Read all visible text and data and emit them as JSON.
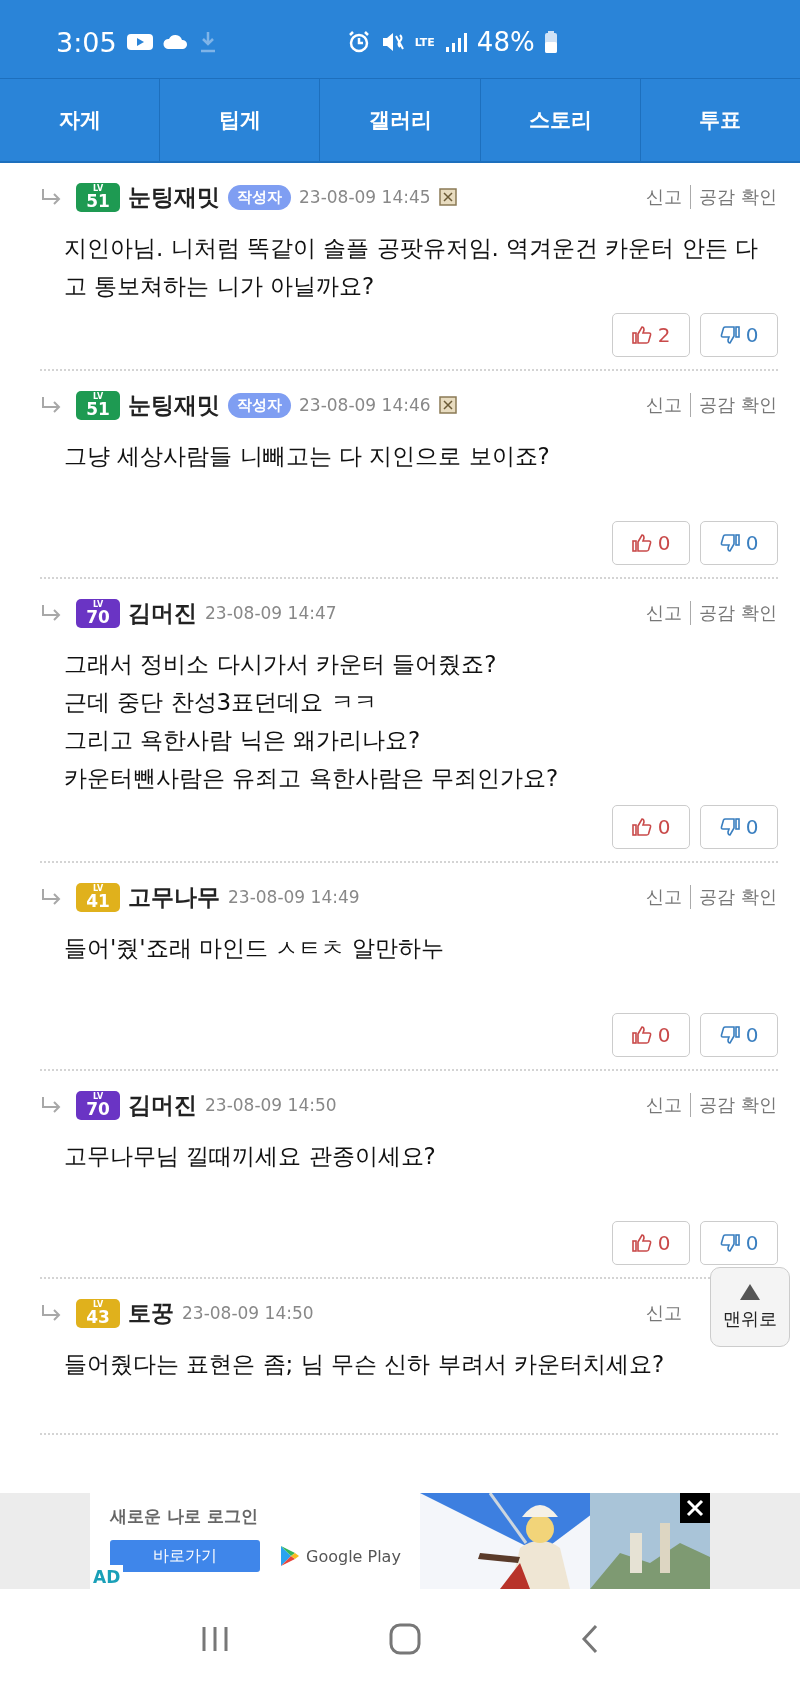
{
  "status_bar": {
    "time": "3:05",
    "network": "LTE",
    "battery": "48%"
  },
  "tabs": [
    {
      "label": "자게",
      "selected": false
    },
    {
      "label": "팁게",
      "selected": false
    },
    {
      "label": "갤러리",
      "selected": false
    },
    {
      "label": "스토리",
      "selected": false
    },
    {
      "label": "투표",
      "selected": false
    }
  ],
  "comments": [
    {
      "lv_label": "LV",
      "level": "51",
      "color": "#1e9a52",
      "author": "눈팅재밋",
      "author_badge": "작성자",
      "date": "23-08-09 14:45",
      "marked": true,
      "actions": [
        "신고",
        "공감 확인"
      ],
      "body": [
        "지인아님. 니처럼 똑같이 솔플 공팟유저임. 역겨운건 카운터 안든 다고 통보쳐하는 니가 아닐까요?"
      ],
      "votes": {
        "up": "2",
        "down": "0"
      }
    },
    {
      "lv_label": "LV",
      "level": "51",
      "color": "#1e9a52",
      "author": "눈팅재밋",
      "author_badge": "작성자",
      "date": "23-08-09 14:46",
      "marked": true,
      "actions": [
        "신고",
        "공감 확인"
      ],
      "body": [
        "그냥 세상사람들 니빼고는 다 지인으로 보이죠?"
      ],
      "votes": {
        "up": "0",
        "down": "0"
      }
    },
    {
      "lv_label": "LV",
      "level": "70",
      "color": "#6a34c4",
      "author": "김머진",
      "date": "23-08-09 14:47",
      "marked": false,
      "actions": [
        "신고",
        "공감 확인"
      ],
      "body": [
        "그래서 정비소 다시가서 카운터 들어줬죠?",
        "근데 중단 찬성3표던데요 ㅋㅋ",
        "그리고 욕한사람 닉은 왜가리나요?",
        "카운터뺀사람은 유죄고 욕한사람은 무죄인가요?"
      ],
      "votes": {
        "up": "0",
        "down": "0"
      }
    },
    {
      "lv_label": "LV",
      "level": "41",
      "color": "#e0b11c",
      "author": "고무나무",
      "date": "23-08-09 14:49",
      "marked": false,
      "actions": [
        "신고",
        "공감 확인"
      ],
      "body": [
        "들어'줬'죠래 마인드 ㅅㅌㅊ 알만하누"
      ],
      "votes": {
        "up": "0",
        "down": "0"
      }
    },
    {
      "lv_label": "LV",
      "level": "70",
      "color": "#6a34c4",
      "author": "김머진",
      "date": "23-08-09 14:50",
      "marked": false,
      "actions": [
        "신고",
        "공감 확인"
      ],
      "body": [
        "고무나무님 낄때끼세요 관종이세요?"
      ],
      "votes": {
        "up": "0",
        "down": "0"
      }
    },
    {
      "lv_label": "LV",
      "level": "43",
      "color": "#e0b11c",
      "author": "토꿍",
      "date": "23-08-09 14:50",
      "marked": false,
      "actions": [
        "신고"
      ],
      "body": [
        "들어줬다는 표현은 좀; 님 무슨 신하 부려서 카운터치세요?"
      ]
    }
  ],
  "top_button": {
    "label": "맨위로"
  },
  "ad": {
    "headline": "새로운 나로 로그인",
    "button": "바로가기",
    "store": "Google Play",
    "tag": "AD",
    "kind": "picture"
  }
}
